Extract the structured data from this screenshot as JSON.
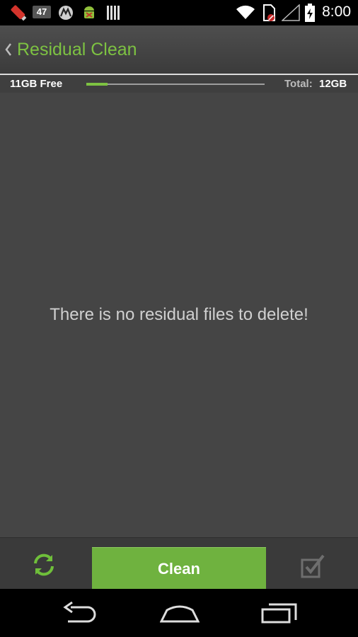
{
  "status_bar": {
    "notification_count": "47",
    "time": "8:00"
  },
  "action_bar": {
    "title": "Residual Clean"
  },
  "storage": {
    "free": "11GB Free",
    "total_label": "Total:",
    "total_value": "12GB",
    "used_fraction": 0.12
  },
  "content": {
    "empty_message": "There is no residual files to delete!"
  },
  "toolbar": {
    "clean_label": "Clean"
  },
  "colors": {
    "accent": "#7dc242",
    "clean_button": "#6fb23f"
  },
  "icons": {
    "back": "chevron-left-icon",
    "refresh": "refresh-icon",
    "select_all": "checkbox-checked-icon",
    "nav_back": "back-arrow-icon",
    "nav_home": "home-icon",
    "nav_recents": "recent-apps-icon"
  }
}
